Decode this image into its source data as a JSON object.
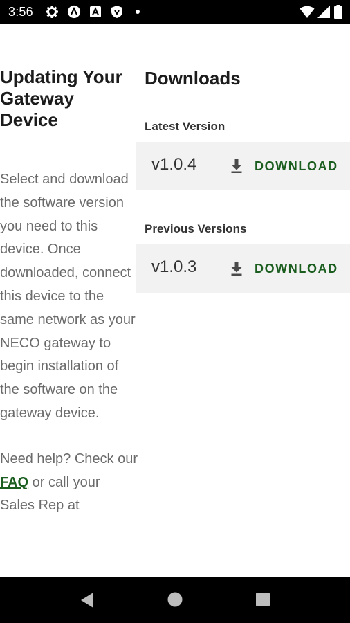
{
  "status_bar": {
    "time": "3:56",
    "left_icons": [
      "gear-icon",
      "a-circle-icon",
      "a-square-icon",
      "shield-icon",
      "dot-icon"
    ],
    "right_icons": [
      "wifi-icon",
      "cell-signal-icon",
      "battery-icon"
    ]
  },
  "left": {
    "title": "Updating Your Gateway Device",
    "intro": "Select and download the software version you need to this device. Once downloaded, connect this device to the same network as your NECO gateway to begin installation of the software on the gateway device.",
    "help_before": "Need help? Check our ",
    "faq_link": "FAQ",
    "help_after": " or call your Sales Rep at"
  },
  "downloads": {
    "title": "Downloads",
    "latest_label": "Latest Version",
    "latest": {
      "version": "v1.0.4",
      "button": "DOWNLOAD"
    },
    "previous_label": "Previous Versions",
    "previous": [
      {
        "version": "v1.0.3",
        "button": "DOWNLOAD"
      }
    ]
  },
  "colors": {
    "accent": "#1b5e20",
    "card_bg": "#f2f2f2",
    "body_text": "#6b6b6b"
  },
  "nav_bar": [
    "back-icon",
    "home-icon",
    "recents-icon"
  ]
}
